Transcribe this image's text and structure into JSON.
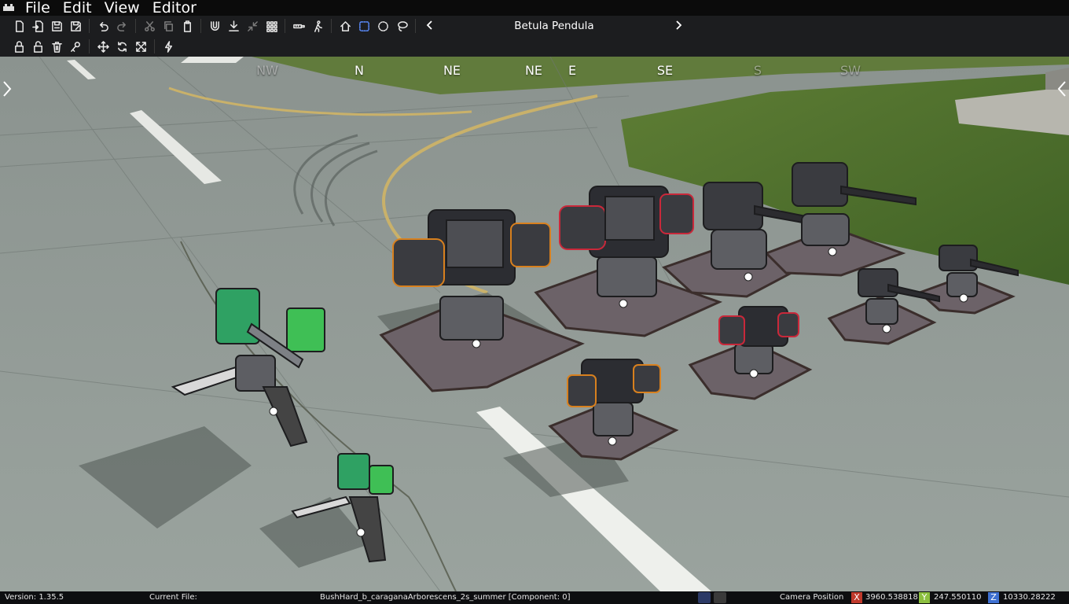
{
  "menu": {
    "logo": "app-logo",
    "items": [
      "File",
      "Edit",
      "View",
      "Editor"
    ]
  },
  "toolbar": {
    "row1": [
      "new-file-icon",
      "import-icon",
      "save-icon",
      "save-as-icon",
      "undo-icon",
      "redo-icon",
      "cut-icon",
      "copy-icon",
      "paste-icon",
      "magnet-icon",
      "drop-to-ground-icon",
      "collapse-icon",
      "grid-icon",
      "ruler-icon",
      "walk-icon",
      "home-icon",
      "rect-select-icon",
      "circle-select-icon",
      "lasso-select-icon"
    ],
    "row2": [
      "lock-icon",
      "unlock-icon",
      "trash-icon",
      "key-icon",
      "move-icon",
      "rotate-icon",
      "scale-icon",
      "lightning-icon"
    ],
    "asset_name": "Betula Pendula",
    "prev_icon": "chevron-left-icon",
    "next_icon": "chevron-right-icon"
  },
  "viewport": {
    "compass": [
      "NW",
      "N",
      "NE",
      "NE",
      "E",
      "SE",
      "S",
      "SW"
    ],
    "left_arrow_icon": "chevron-right-icon",
    "right_arrow_icon": "chevron-left-icon"
  },
  "status": {
    "version": "Version:  1.35.5",
    "current_file_label": "Current File:",
    "current_file": "BushHard_b_caraganaArborescens_2s_summer [Component: 0]",
    "camera_label": "Camera Position",
    "x_label": "X",
    "x_value": "3960.538818",
    "y_label": "Y",
    "y_value": "247.550110",
    "z_label": "Z",
    "z_value": "10330.28222",
    "colors": {
      "x": "#c0392b",
      "y": "#8cbf3f",
      "z": "#3d6fd1"
    }
  }
}
